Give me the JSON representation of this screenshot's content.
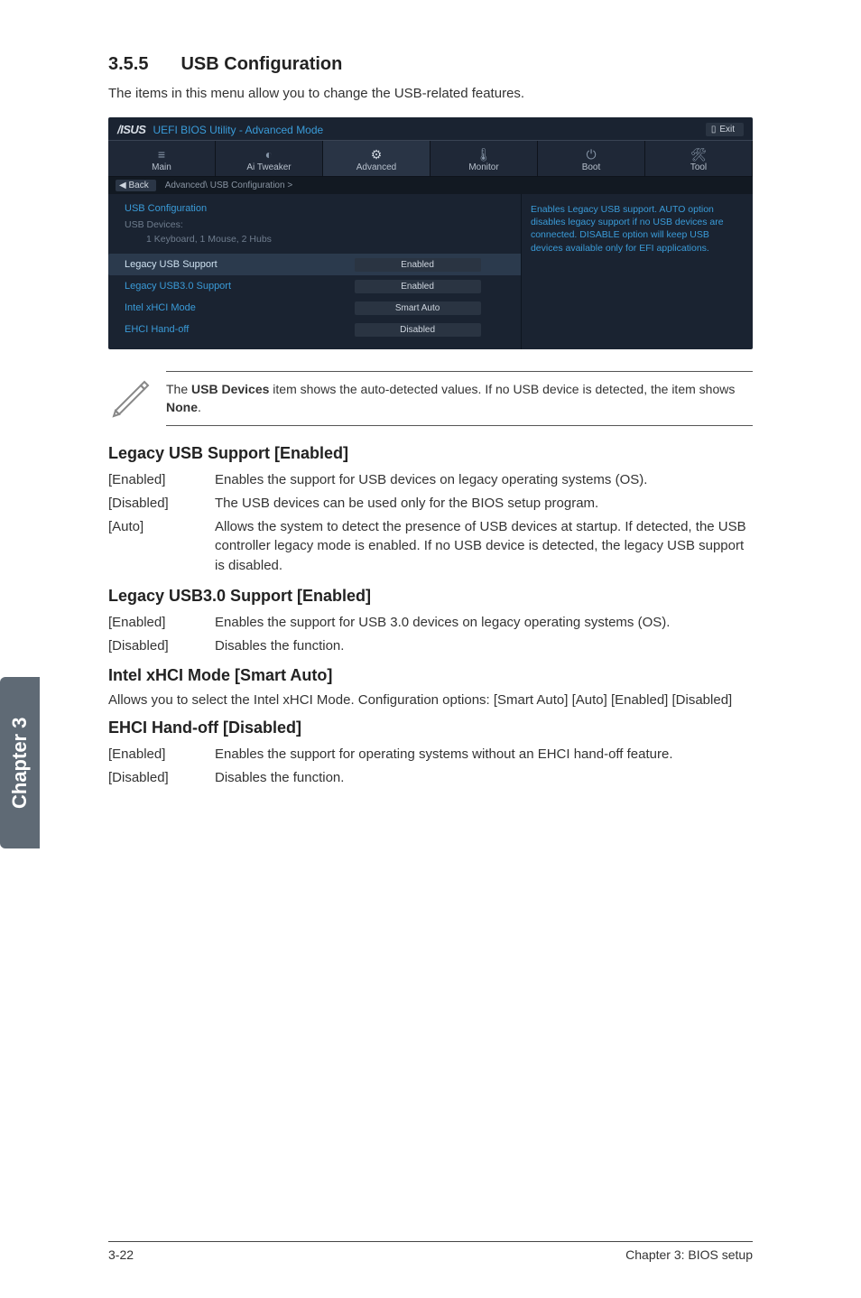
{
  "section": {
    "number": "3.5.5",
    "title": "USB Configuration"
  },
  "intro": "The items in this menu allow you to change the USB-related features.",
  "bios": {
    "brand": "/ISUS",
    "title": "UEFI BIOS Utility - Advanced Mode",
    "exit_label": "Exit",
    "tabs": {
      "main": "Main",
      "tweaker": "Ai Tweaker",
      "advanced": "Advanced",
      "monitor": "Monitor",
      "boot": "Boot",
      "tool": "Tool"
    },
    "back_label": "Back",
    "breadcrumb": "Advanced\\ USB Configuration  >",
    "panel_title": "USB Configuration",
    "devices_label": "USB Devices:",
    "devices_value": "1 Keyboard, 1 Mouse, 2 Hubs",
    "rows": {
      "legacy_usb": {
        "label": "Legacy USB Support",
        "value": "Enabled"
      },
      "legacy_usb3": {
        "label": "Legacy USB3.0 Support",
        "value": "Enabled"
      },
      "xhci": {
        "label": "Intel xHCI Mode",
        "value": "Smart Auto"
      },
      "ehci": {
        "label": "EHCI Hand-off",
        "value": "Disabled"
      }
    },
    "help_text": "Enables Legacy USB support. AUTO option disables legacy support if no USB devices are connected. DISABLE option will keep USB devices available only for EFI applications."
  },
  "note": "The USB Devices item shows the auto-detected values. If no USB device is detected, the item shows None.",
  "note_bold1": "USB Devices",
  "note_bold2": "None",
  "legacy_usb": {
    "heading": "Legacy USB Support [Enabled]",
    "enabled_key": "[Enabled]",
    "enabled_val": "Enables the support for USB devices on legacy operating systems (OS).",
    "disabled_key": "[Disabled]",
    "disabled_val": "The USB devices can be used only for the BIOS setup program.",
    "auto_key": "[Auto]",
    "auto_val": "Allows the system to detect the presence of USB devices at startup. If detected, the USB controller legacy mode is enabled. If no USB device is detected, the legacy USB support is disabled."
  },
  "legacy_usb3": {
    "heading": "Legacy USB3.0 Support [Enabled]",
    "enabled_key": "[Enabled]",
    "enabled_val": "Enables the support for USB 3.0 devices on legacy operating systems (OS).",
    "disabled_key": "[Disabled]",
    "disabled_val": "Disables the function."
  },
  "xhci": {
    "heading": "Intel xHCI Mode [Smart Auto]",
    "body": "Allows you to select the Intel xHCI Mode. Configuration options: [Smart Auto] [Auto] [Enabled] [Disabled]"
  },
  "ehci": {
    "heading": "EHCI Hand-off [Disabled]",
    "enabled_key": "[Enabled]",
    "enabled_val": "Enables the support for operating systems without an EHCI hand-off feature.",
    "disabled_key": "[Disabled]",
    "disabled_val": "Disables the function."
  },
  "chapter_tab": "Chapter 3",
  "footer": {
    "left": "3-22",
    "right": "Chapter 3: BIOS setup"
  }
}
